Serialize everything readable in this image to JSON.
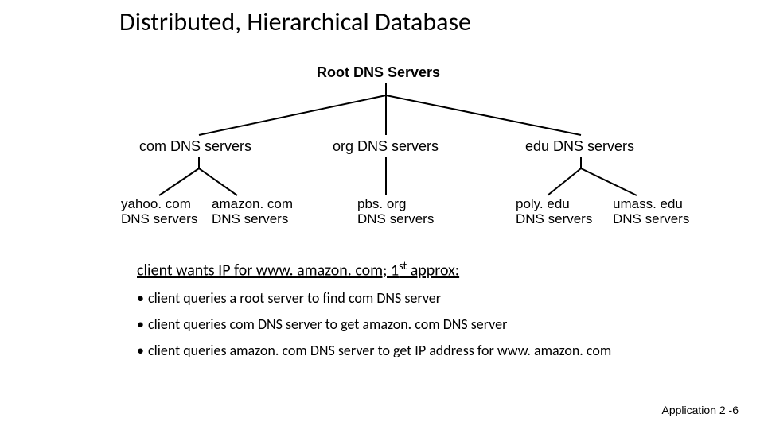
{
  "title": "Distributed, Hierarchical Database",
  "tree": {
    "root": "Root DNS Servers",
    "tld": {
      "com": "com DNS servers",
      "org": "org DNS servers",
      "edu": "edu DNS servers"
    },
    "leaves": {
      "yahoo_l1": "yahoo. com",
      "yahoo_l2": "DNS servers",
      "amazon_l1": "amazon. com",
      "amazon_l2": "DNS servers",
      "pbs_l1": "pbs. org",
      "pbs_l2": "DNS servers",
      "poly_l1": "poly. edu",
      "poly_l2": "DNS servers",
      "umass_l1": "umass. edu",
      "umass_l2": "DNS servers"
    }
  },
  "body": {
    "heading_pre": "client wants IP for www. amazon. com; 1",
    "heading_sup": "st",
    "heading_post": " approx:",
    "bullet1": "client queries a root server to find com DNS server",
    "bullet2": "client queries com DNS server to get amazon. com DNS server",
    "bullet3": "client queries amazon. com DNS server to get  IP address for www. amazon. com"
  },
  "footer": "Application  2 -6"
}
